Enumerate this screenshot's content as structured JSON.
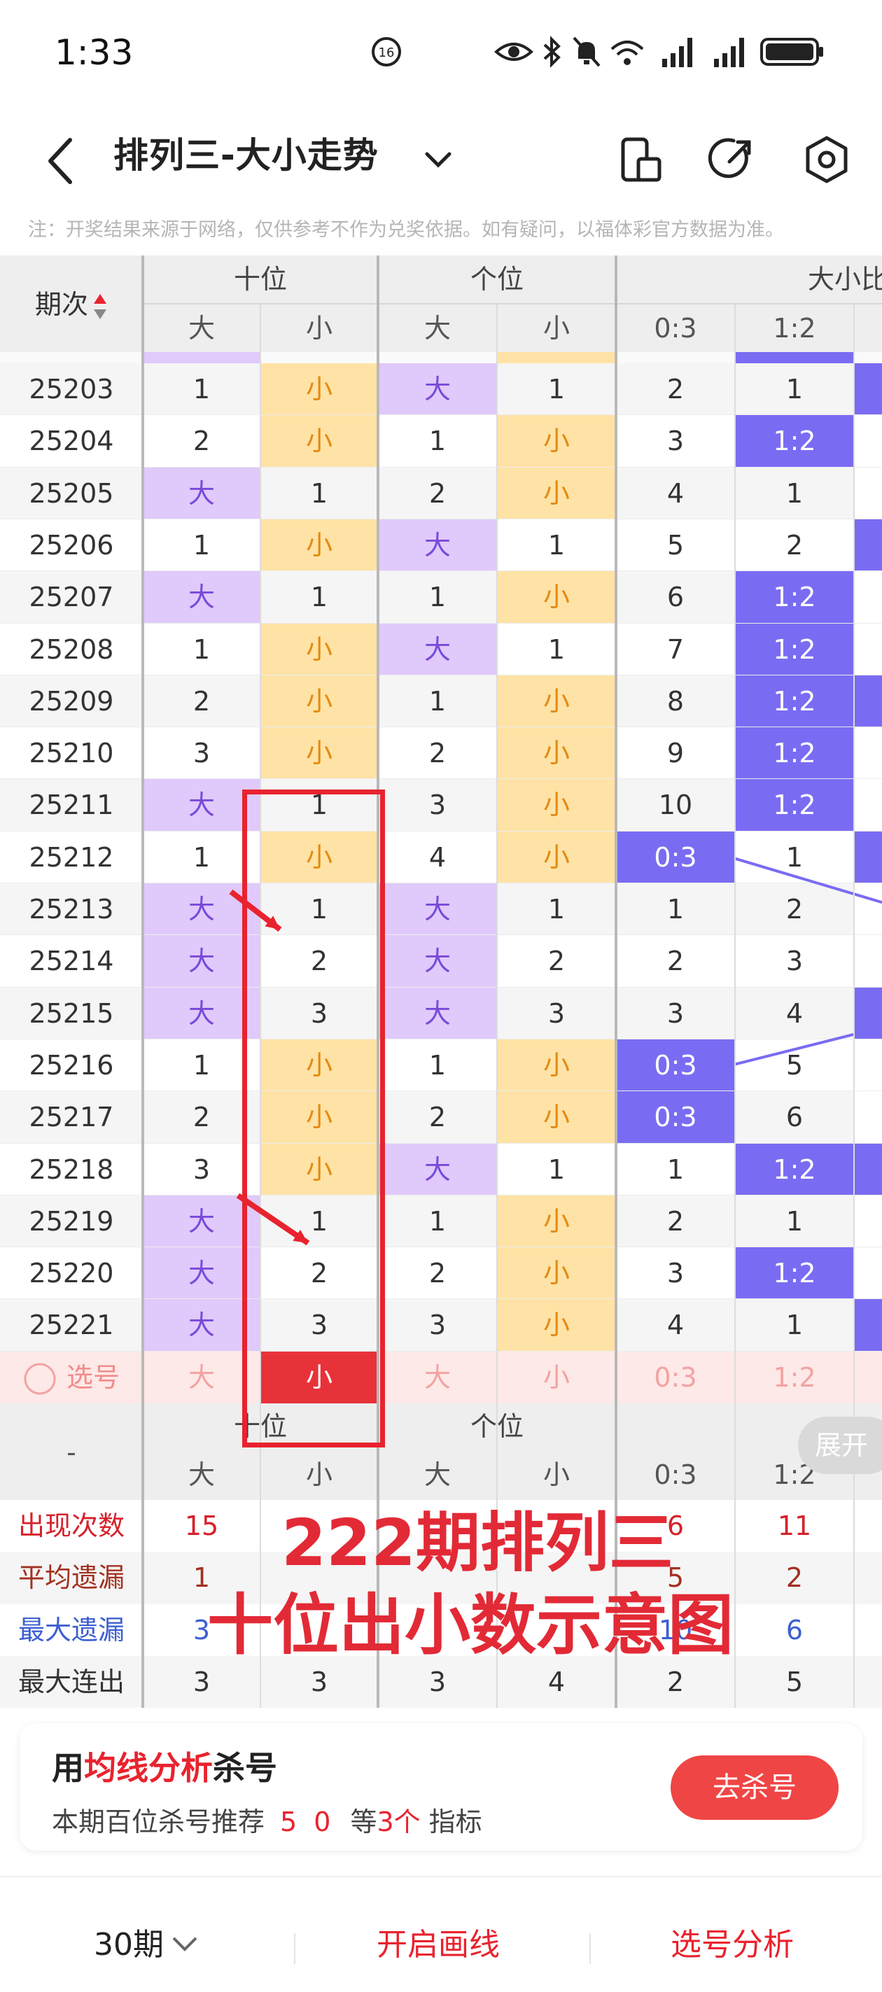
{
  "status": {
    "time": "1:33"
  },
  "nav": {
    "title": "排列三-大小走势"
  },
  "notice": "注：开奖结果来源于网络，仅供参考不作为兑奖依据。如有疑问，以福体彩官方数据为准。",
  "table": {
    "period_header": "期次",
    "groups": [
      "十位",
      "个位",
      "大小比"
    ],
    "subheaders": [
      "大",
      "小",
      "大",
      "小",
      "0:3",
      "1:2"
    ],
    "rows": [
      {
        "period": "25203",
        "c": [
          "1",
          "小",
          "大",
          "1",
          "2",
          "1"
        ]
      },
      {
        "period": "25204",
        "c": [
          "2",
          "小",
          "1",
          "小",
          "3",
          "1:2"
        ]
      },
      {
        "period": "25205",
        "c": [
          "大",
          "1",
          "2",
          "小",
          "4",
          "1"
        ]
      },
      {
        "period": "25206",
        "c": [
          "1",
          "小",
          "大",
          "1",
          "5",
          "2"
        ]
      },
      {
        "period": "25207",
        "c": [
          "大",
          "1",
          "1",
          "小",
          "6",
          "1:2"
        ]
      },
      {
        "period": "25208",
        "c": [
          "1",
          "小",
          "大",
          "1",
          "7",
          "1:2"
        ]
      },
      {
        "period": "25209",
        "c": [
          "2",
          "小",
          "1",
          "小",
          "8",
          "1:2"
        ]
      },
      {
        "period": "25210",
        "c": [
          "3",
          "小",
          "2",
          "小",
          "9",
          "1:2"
        ]
      },
      {
        "period": "25211",
        "c": [
          "大",
          "1",
          "3",
          "小",
          "10",
          "1:2"
        ]
      },
      {
        "period": "25212",
        "c": [
          "1",
          "小",
          "4",
          "小",
          "0:3",
          "1"
        ]
      },
      {
        "period": "25213",
        "c": [
          "大",
          "1",
          "大",
          "1",
          "1",
          "2"
        ]
      },
      {
        "period": "25214",
        "c": [
          "大",
          "2",
          "大",
          "2",
          "2",
          "3"
        ]
      },
      {
        "period": "25215",
        "c": [
          "大",
          "3",
          "大",
          "3",
          "3",
          "4"
        ]
      },
      {
        "period": "25216",
        "c": [
          "1",
          "小",
          "1",
          "小",
          "0:3",
          "5"
        ]
      },
      {
        "period": "25217",
        "c": [
          "2",
          "小",
          "2",
          "小",
          "0:3",
          "6"
        ]
      },
      {
        "period": "25218",
        "c": [
          "3",
          "小",
          "大",
          "1",
          "1",
          "1:2"
        ]
      },
      {
        "period": "25219",
        "c": [
          "大",
          "1",
          "1",
          "小",
          "2",
          "1"
        ]
      },
      {
        "period": "25220",
        "c": [
          "大",
          "2",
          "2",
          "小",
          "3",
          "1:2"
        ]
      },
      {
        "period": "25221",
        "c": [
          "大",
          "3",
          "3",
          "小",
          "4",
          "1"
        ]
      }
    ],
    "select_row": {
      "label": "选号",
      "c": [
        "大",
        "小",
        "大",
        "小",
        "0:3",
        "1:2"
      ]
    },
    "footer_groups": [
      "十位",
      "个位"
    ],
    "footer_dash": "-",
    "expand_label": "展开",
    "stats": [
      {
        "label": "出现次数",
        "c": [
          "15",
          "",
          "",
          "",
          "6",
          "11"
        ]
      },
      {
        "label": "平均遗漏",
        "c": [
          "1",
          "",
          "",
          "",
          "5",
          "2"
        ]
      },
      {
        "label": "最大遗漏",
        "c": [
          "3",
          "",
          "",
          "",
          "10",
          "6"
        ]
      },
      {
        "label": "最大连出",
        "c": [
          "3",
          "3",
          "3",
          "4",
          "2",
          "5"
        ]
      }
    ]
  },
  "overlay": {
    "line1": "222期排列三",
    "line2": "十位出小数示意图"
  },
  "card": {
    "title_pre": "用",
    "title_hl": "均线分析",
    "title_post": "杀号",
    "sub_pre": "本期百位杀号推荐",
    "sub_nums": "5 0",
    "sub_mid": "等",
    "sub_count": "3个",
    "sub_post": "指标",
    "button": "去杀号"
  },
  "bottom": {
    "periods": "30期",
    "draw": "开启画线",
    "analysis": "选号分析"
  },
  "colors": {
    "purple_cell": "#e0c9fb",
    "yellow_cell": "#ffe3a6",
    "blue_cell": "#7a6cf2",
    "accent_red": "#e8232e"
  }
}
